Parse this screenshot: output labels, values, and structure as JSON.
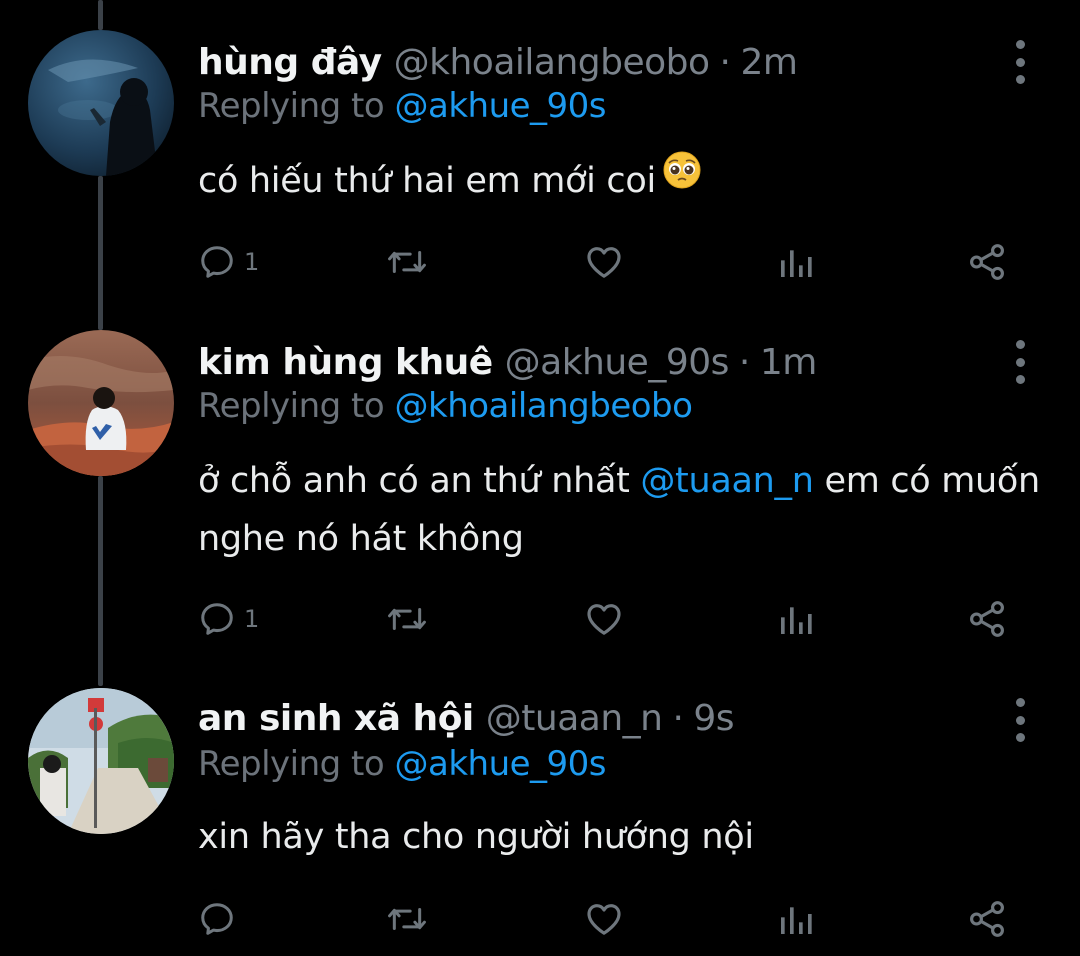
{
  "colors": {
    "background": "#000000",
    "name": "#f1f3f4",
    "secondary": "#7a828b",
    "link": "#1d9bf0",
    "icon": "#6e767d",
    "thread_line": "#3b4148"
  },
  "tweets": [
    {
      "display_name": "hùng đây",
      "handle": "@khoailangbeobo",
      "dot": "·",
      "time": "2m",
      "reply_prefix": "Replying to ",
      "reply_to": "@akhue_90s",
      "text": "có hiếu thứ hai em mới coi",
      "emoji": "pleading-face-emoji",
      "reply_count": "1",
      "icons": [
        "reply-icon",
        "retweet-icon",
        "like-icon",
        "analytics-icon",
        "share-icon",
        "more-options-icon"
      ]
    },
    {
      "display_name": "kim hùng khuê",
      "handle": "@akhue_90s",
      "dot": "·",
      "time": "1m",
      "reply_prefix": "Replying to ",
      "reply_to": "@khoailangbeobo",
      "text_before": "ở chỗ anh có an thứ nhất ",
      "text_mention": "@tuaan_n",
      "text_after": " em có muốn nghe nó hát không",
      "reply_count": "1"
    },
    {
      "display_name": "an sinh xã hội",
      "handle": "@tuaan_n",
      "dot": "·",
      "time": "9s",
      "reply_prefix": "Replying to ",
      "reply_to": "@akhue_90s",
      "text": "xin hãy tha cho người hướng nội",
      "reply_count": ""
    }
  ]
}
